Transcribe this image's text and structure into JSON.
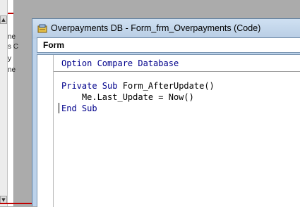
{
  "background_window": {
    "text_lines": [
      "ne",
      "s C",
      "y",
      "ne"
    ]
  },
  "code_window": {
    "title": "Overpayments DB - Form_frm_Overpayments (Code)",
    "object_combo_value": "Form",
    "declarations_line": "Option Compare Database",
    "procedure": {
      "kw_private_sub": "Private Sub",
      "name": "Form_AfterUpdate()",
      "body_line": "    Me.Last_Update = Now()",
      "kw_end_sub": "End Sub"
    }
  },
  "colors": {
    "keyword": "#00008b",
    "title_bar": "#bcd2ea",
    "accent_red": "#c00000"
  }
}
